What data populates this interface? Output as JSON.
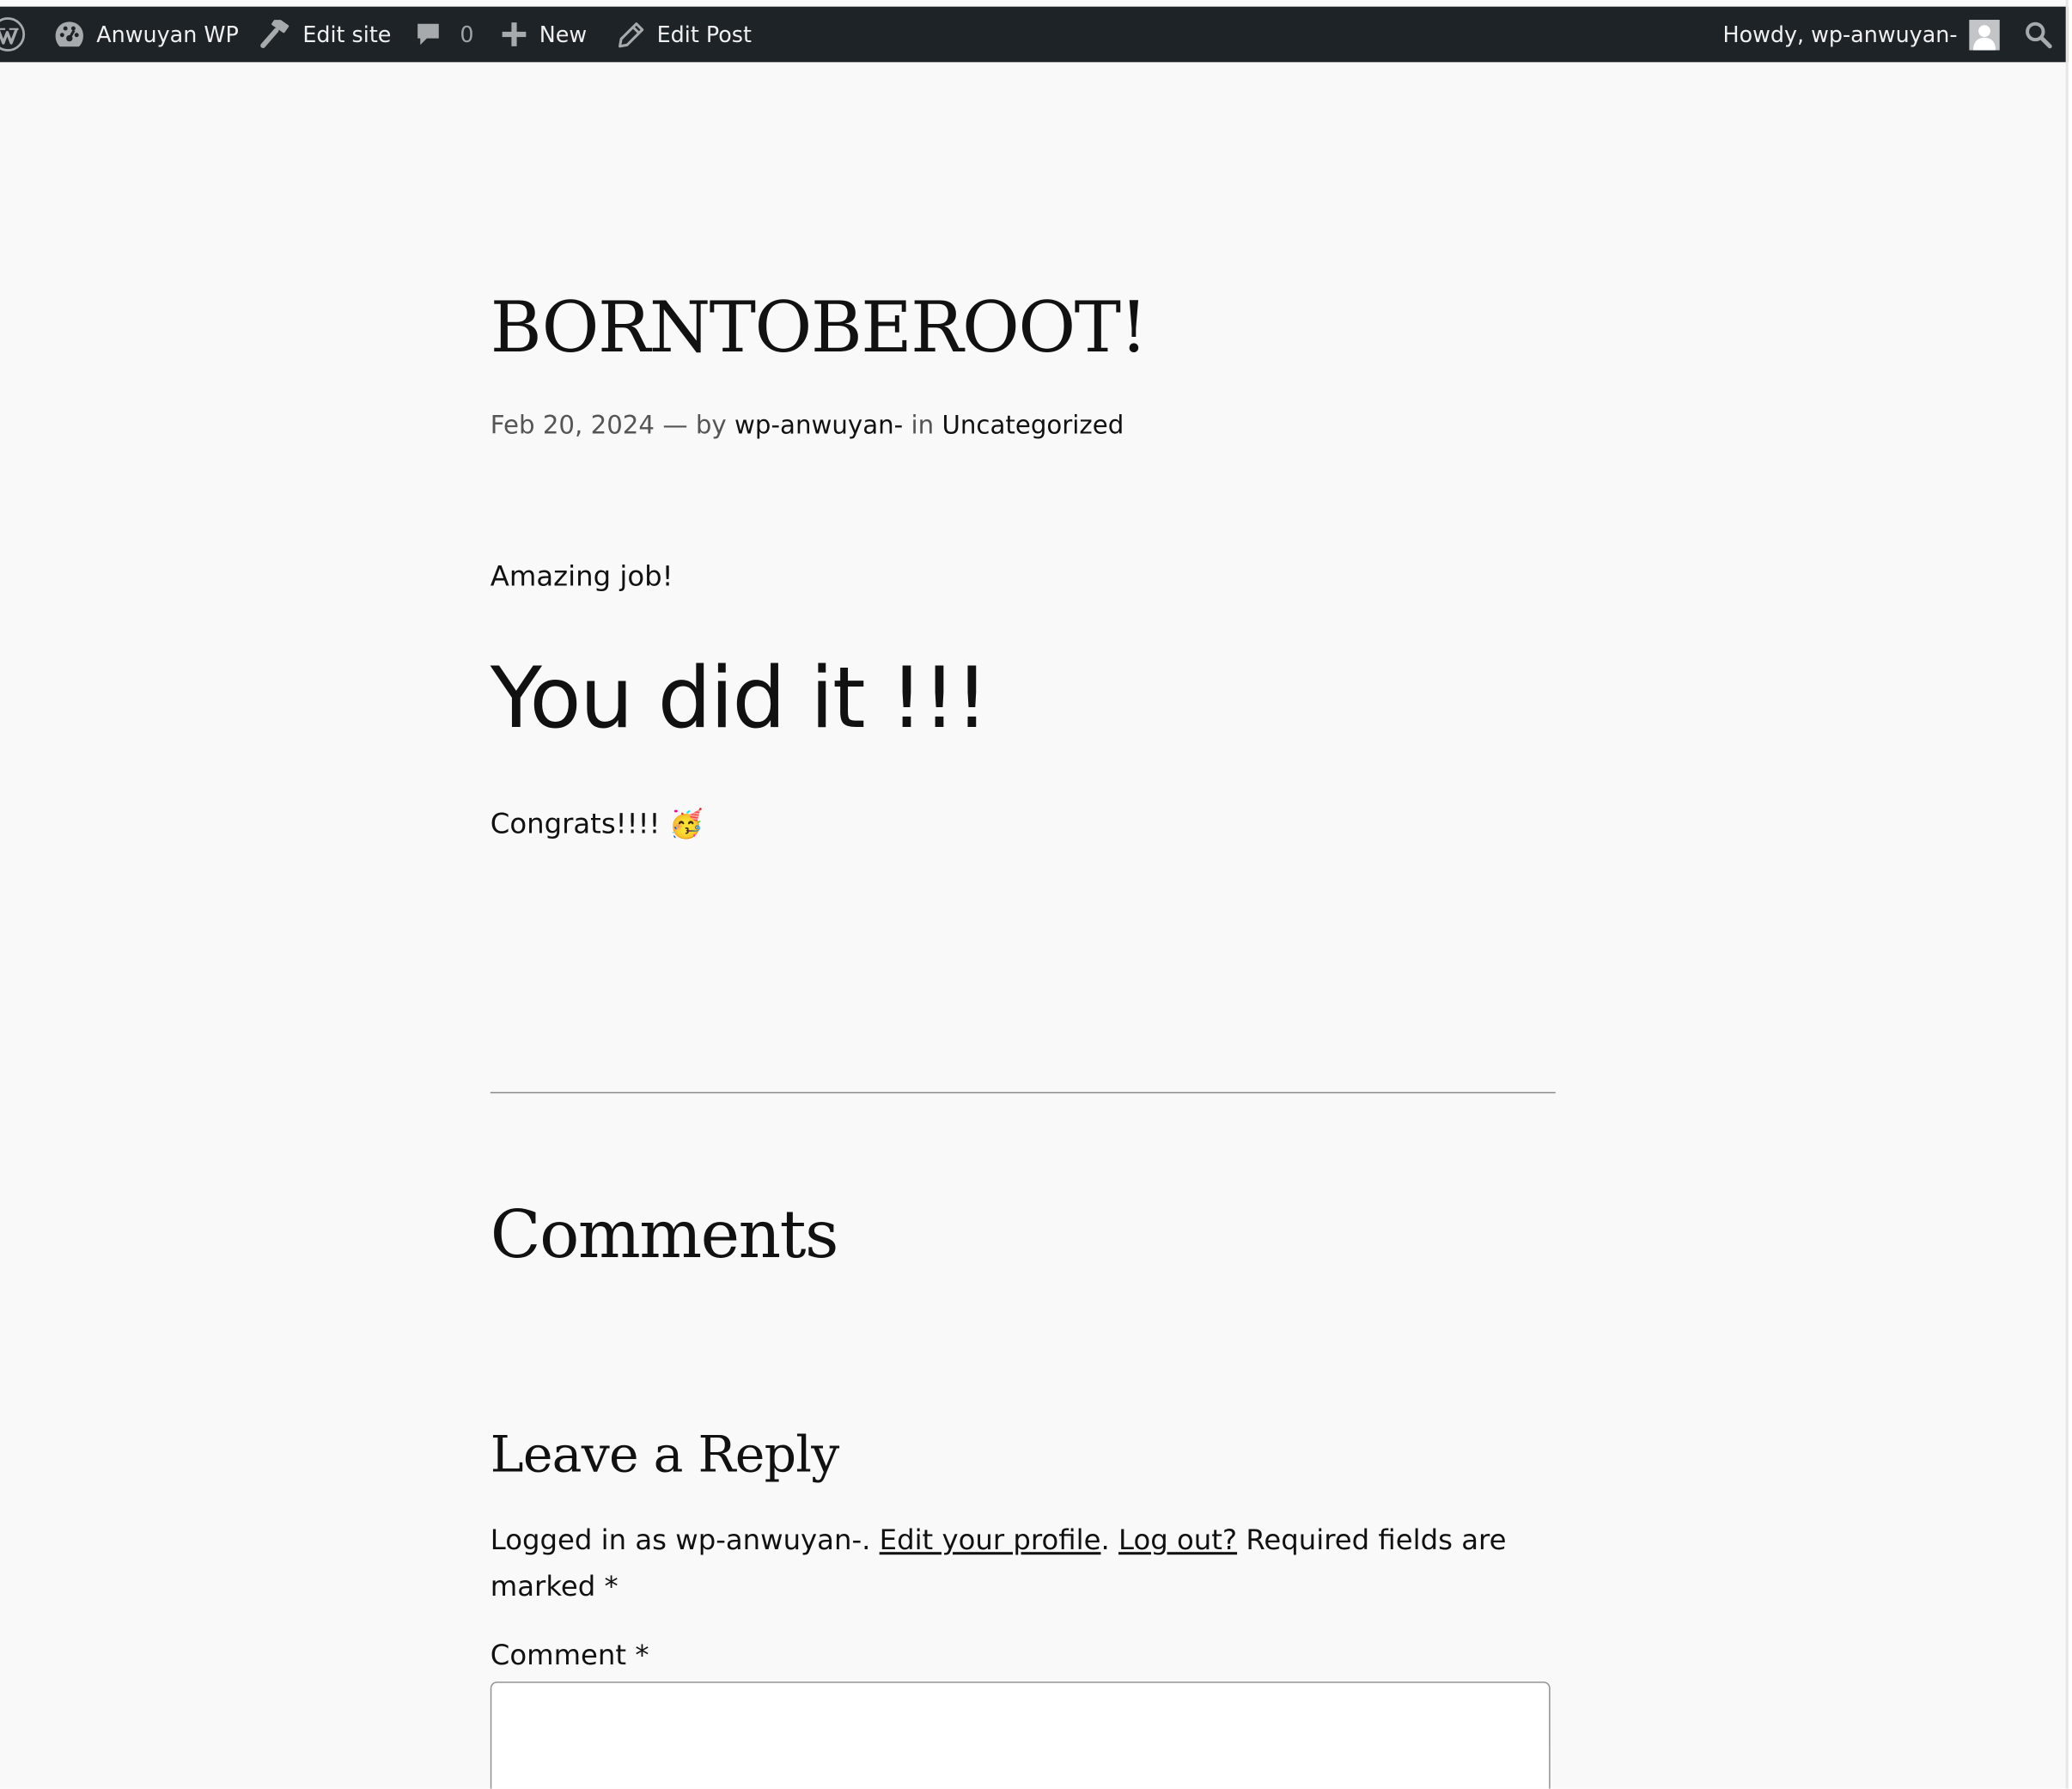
{
  "admin_bar": {
    "site_name": "Anwuyan WP",
    "edit_site_label": "Edit site",
    "comments_count": "0",
    "new_label": "New",
    "edit_post_label": "Edit Post",
    "howdy_label": "Howdy, wp-anwuyan-",
    "icons": {
      "wordpress": "wordpress-logo-icon",
      "site": "dashboard-icon",
      "edit_site": "hammer-icon",
      "comments": "comment-bubble-icon",
      "new": "plus-icon",
      "edit_post": "pencil-icon",
      "account": "avatar",
      "search": "search-icon"
    },
    "colors": {
      "background": "#1d2327",
      "text": "#f0f0f1",
      "muted": "#9ca2a7"
    }
  },
  "post": {
    "title": "BORNTOBEROOT!",
    "date": "Feb 20, 2024",
    "separator": "—",
    "by": "by",
    "author": "wp-anwuyan-",
    "in": "in",
    "category": "Uncategorized",
    "paragraph_1": "Amazing job!",
    "heading": "You did it !!!",
    "paragraph_2_text": "Congrats!!!!",
    "paragraph_2_emoji": "🥳"
  },
  "comments": {
    "title": "Comments",
    "reply_title": "Leave a Reply",
    "logged_in_prefix": "Logged in as wp-anwuyan-. ",
    "edit_profile_label": "Edit your profile",
    "after_edit_profile": ". ",
    "log_out_label": "Log out?",
    "required_note": " Required fields are marked ",
    "required_mark": "*",
    "comment_label": "Comment *",
    "comment_value": ""
  },
  "colors": {
    "page_background": "#f9f9f9",
    "text": "#111111",
    "meta_text": "#555555",
    "divider": "#8c8c8c",
    "input_border": "#949494"
  }
}
